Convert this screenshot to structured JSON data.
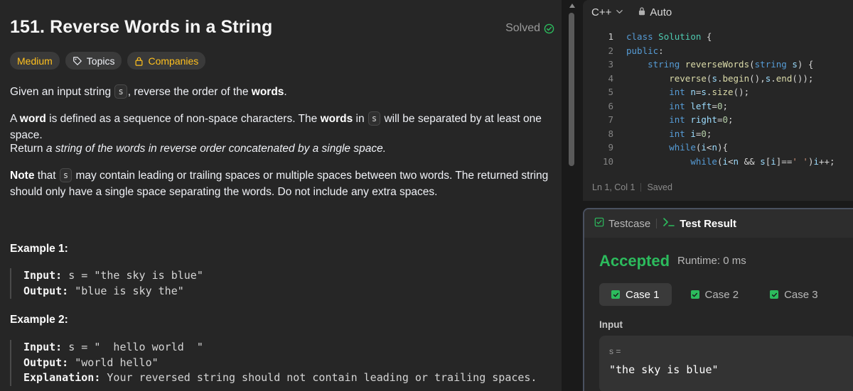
{
  "problem": {
    "title": "151. Reverse Words in a String",
    "solved_label": "Solved",
    "tags": {
      "difficulty": "Medium",
      "topics": "Topics",
      "companies": "Companies"
    },
    "desc": {
      "p1": [
        "Given an input string ",
        "s",
        ", reverse the order of the ",
        "words",
        "."
      ],
      "p2": [
        "A ",
        "word",
        " is defined as a sequence of non-space characters. The ",
        "words",
        " in ",
        "s",
        " will be separated by at least one space."
      ],
      "p3": [
        "Return ",
        "a string of the words in reverse order concatenated by a single space."
      ],
      "p4": [
        "Note",
        " that ",
        "s",
        " may contain leading or trailing spaces or multiple spaces between two words. The returned string should only have a single space separating the words. Do not include any extra spaces."
      ]
    },
    "examples": [
      {
        "title": "Example 1:",
        "input_label": "Input:",
        "input_value": "s = \"the sky is blue\"",
        "output_label": "Output:",
        "output_value": "\"blue is sky the\""
      },
      {
        "title": "Example 2:",
        "input_label": "Input:",
        "input_value": "s = \"  hello world  \"",
        "output_label": "Output:",
        "output_value": "\"world hello\"",
        "explanation_label": "Explanation:",
        "explanation_value": "Your reversed string should not contain leading or trailing spaces."
      }
    ]
  },
  "editor": {
    "language": "C++",
    "mode": "Auto",
    "status_position": "Ln 1, Col 1",
    "status_saved": "Saved",
    "line_numbers": [
      "1",
      "2",
      "3",
      "4",
      "5",
      "6",
      "7",
      "8",
      "9",
      "10"
    ],
    "lines": [
      [
        [
          "kw",
          "class"
        ],
        [
          "pl",
          " "
        ],
        [
          "cls",
          "Solution"
        ],
        [
          "pl",
          " {"
        ]
      ],
      [
        [
          "kw",
          "public"
        ],
        [
          "pl",
          ":"
        ]
      ],
      [
        [
          "pl",
          "    "
        ],
        [
          "kw",
          "string"
        ],
        [
          "pl",
          " "
        ],
        [
          "fn",
          "reverseWords"
        ],
        [
          "pl",
          "("
        ],
        [
          "kw",
          "string"
        ],
        [
          "pl",
          " "
        ],
        [
          "var",
          "s"
        ],
        [
          "pl",
          ") {"
        ]
      ],
      [
        [
          "pl",
          "        "
        ],
        [
          "fn",
          "reverse"
        ],
        [
          "pl",
          "("
        ],
        [
          "var",
          "s"
        ],
        [
          "pl",
          "."
        ],
        [
          "fn",
          "begin"
        ],
        [
          "pl",
          "(),"
        ],
        [
          "var",
          "s"
        ],
        [
          "pl",
          "."
        ],
        [
          "fn",
          "end"
        ],
        [
          "pl",
          "());"
        ]
      ],
      [
        [
          "pl",
          "        "
        ],
        [
          "kw",
          "int"
        ],
        [
          "pl",
          " "
        ],
        [
          "var",
          "n"
        ],
        [
          "pl",
          "="
        ],
        [
          "var",
          "s"
        ],
        [
          "pl",
          "."
        ],
        [
          "fn",
          "size"
        ],
        [
          "pl",
          "();"
        ]
      ],
      [
        [
          "pl",
          "        "
        ],
        [
          "kw",
          "int"
        ],
        [
          "pl",
          " "
        ],
        [
          "var",
          "left"
        ],
        [
          "pl",
          "="
        ],
        [
          "num",
          "0"
        ],
        [
          "pl",
          ";"
        ]
      ],
      [
        [
          "pl",
          "        "
        ],
        [
          "kw",
          "int"
        ],
        [
          "pl",
          " "
        ],
        [
          "var",
          "right"
        ],
        [
          "pl",
          "="
        ],
        [
          "num",
          "0"
        ],
        [
          "pl",
          ";"
        ]
      ],
      [
        [
          "pl",
          "        "
        ],
        [
          "kw",
          "int"
        ],
        [
          "pl",
          " "
        ],
        [
          "var",
          "i"
        ],
        [
          "pl",
          "="
        ],
        [
          "num",
          "0"
        ],
        [
          "pl",
          ";"
        ]
      ],
      [
        [
          "pl",
          "        "
        ],
        [
          "kw",
          "while"
        ],
        [
          "pl",
          "("
        ],
        [
          "var",
          "i"
        ],
        [
          "pl",
          "<"
        ],
        [
          "var",
          "n"
        ],
        [
          "pl",
          "){"
        ]
      ],
      [
        [
          "pl",
          "            "
        ],
        [
          "kw",
          "while"
        ],
        [
          "pl",
          "("
        ],
        [
          "var",
          "i"
        ],
        [
          "pl",
          "<"
        ],
        [
          "var",
          "n"
        ],
        [
          "pl",
          " && "
        ],
        [
          "var",
          "s"
        ],
        [
          "pl",
          "["
        ],
        [
          "var",
          "i"
        ],
        [
          "pl",
          "]=="
        ],
        [
          "str",
          "' '"
        ],
        [
          "pl",
          ")"
        ],
        [
          "var",
          "i"
        ],
        [
          "pl",
          "++;"
        ]
      ]
    ]
  },
  "result": {
    "tab_testcase": "Testcase",
    "tab_result": "Test Result",
    "status": "Accepted",
    "runtime": "Runtime: 0 ms",
    "cases": [
      "Case 1",
      "Case 2",
      "Case 3"
    ],
    "input_label": "Input",
    "var_name": "s =",
    "var_value": "\"the sky is blue\""
  },
  "colors": {
    "accent_green": "#2cbb5d",
    "difficulty_medium": "#ffc01e",
    "panel_bg": "#262626",
    "app_bg": "#1a1a1a"
  }
}
